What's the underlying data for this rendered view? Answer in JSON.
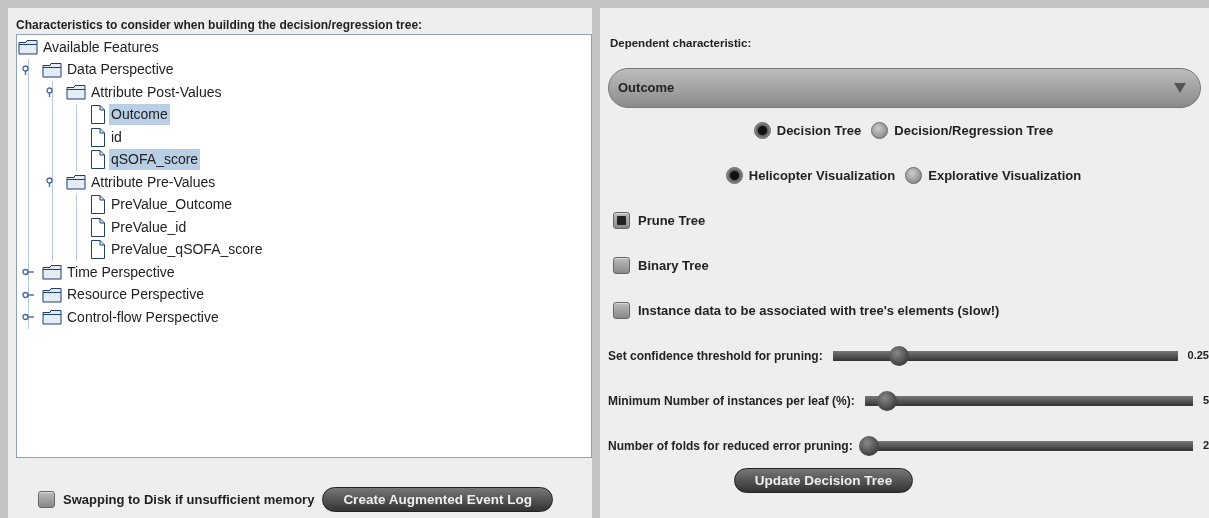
{
  "left_panel": {
    "title": "Characteristics to consider when building the decision/regression tree:",
    "tree": [
      {
        "label": "Available Features",
        "kind": "folder",
        "selected": false,
        "children": [
          {
            "label": "Data Perspective",
            "kind": "folder",
            "selected": false,
            "expanded": true,
            "children": [
              {
                "label": "Attribute Post-Values",
                "kind": "folder",
                "selected": false,
                "expanded": true,
                "children": [
                  {
                    "label": "Outcome",
                    "kind": "file",
                    "selected": true
                  },
                  {
                    "label": "id",
                    "kind": "file",
                    "selected": false
                  },
                  {
                    "label": "qSOFA_score",
                    "kind": "file",
                    "selected": true
                  }
                ]
              },
              {
                "label": "Attribute Pre-Values",
                "kind": "folder",
                "selected": false,
                "expanded": true,
                "children": [
                  {
                    "label": "PreValue_Outcome",
                    "kind": "file",
                    "selected": false
                  },
                  {
                    "label": "PreValue_id",
                    "kind": "file",
                    "selected": false
                  },
                  {
                    "label": "PreValue_qSOFA_score",
                    "kind": "file",
                    "selected": false
                  }
                ]
              }
            ]
          },
          {
            "label": "Time Perspective",
            "kind": "folder",
            "selected": false,
            "expanded": false
          },
          {
            "label": "Resource Perspective",
            "kind": "folder",
            "selected": false,
            "expanded": false
          },
          {
            "label": "Control-flow Perspective",
            "kind": "folder",
            "selected": false,
            "expanded": false
          }
        ]
      }
    ],
    "swap_checkbox": {
      "label": "Swapping to Disk if unsufficient memory",
      "checked": false
    },
    "create_button": "Create Augmented Event Log"
  },
  "right_panel": {
    "dependent_label": "Dependent characteristic:",
    "dependent_value": "Outcome",
    "radio_groups": [
      [
        {
          "label": "Decision Tree",
          "selected": true
        },
        {
          "label": "Decision/Regression Tree",
          "selected": false
        }
      ],
      [
        {
          "label": "Helicopter Visualization",
          "selected": true
        },
        {
          "label": "Explorative Visualization",
          "selected": false
        }
      ]
    ],
    "checkboxes": [
      {
        "label": "Prune Tree",
        "checked": true
      },
      {
        "label": "Binary Tree",
        "checked": false
      },
      {
        "label": "Instance data to be associated with tree's elements (slow!)",
        "checked": false
      }
    ],
    "sliders": [
      {
        "label": "Set confidence threshold for pruning:",
        "level": 0.18,
        "reading": "0.25"
      },
      {
        "label": "Minimum Number of instances per leaf (%):",
        "level": 0.05,
        "reading": "5"
      },
      {
        "label": "Number of folds for reduced error pruning:",
        "level": 0.0,
        "reading": "2"
      }
    ],
    "update_button": "Update Decision Tree"
  }
}
